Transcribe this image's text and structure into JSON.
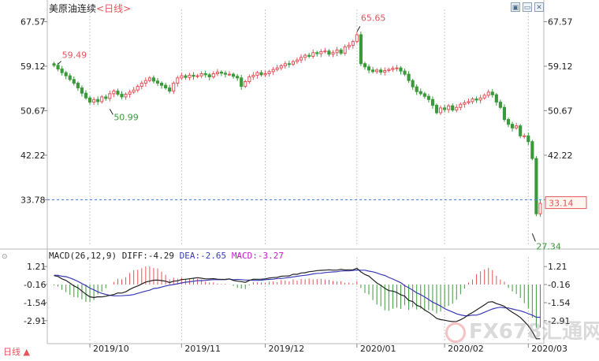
{
  "window": {
    "title": "美原油连续",
    "period": "<日线>",
    "bottom_label": "日线 ▲",
    "watermark": "FX678汇通网"
  },
  "macd_header": {
    "params": "MACD(26,12,9)",
    "diff": "DIFF:-4.29",
    "dea": "DEA:-2.65",
    "macd": "MACD:-3.27"
  },
  "colors": {
    "up": "#e4545a",
    "down": "#3a9a3a",
    "dashed_line": "#3a7ad8",
    "diff_line": "#222222",
    "dea_line": "#3a3ab8",
    "current_label_bg": "#fff6f0",
    "current_label_border": "#e4545a"
  },
  "chart_data": {
    "type": "candlestick",
    "x_ticks": [
      "2019/10",
      "2019/11",
      "2019/12",
      "2020/01",
      "2020/02",
      "2020/03"
    ],
    "y_ticks": [
      67.57,
      59.12,
      50.67,
      42.22,
      33.78
    ],
    "y_tick_labels": [
      "67.57",
      "59.12",
      "50.67",
      "42.22",
      "33.78"
    ],
    "ylim": [
      25.0,
      69.0
    ],
    "current_price": "33.14",
    "current_price_value": 33.14,
    "annotations": [
      {
        "text": "59.49",
        "value": 59.49,
        "color": "up"
      },
      {
        "text": "50.99",
        "value": 50.99,
        "color": "down"
      },
      {
        "text": "65.65",
        "value": 65.65,
        "color": "up"
      },
      {
        "text": "27.34",
        "value": 27.34,
        "color": "down"
      }
    ],
    "closes": [
      59.3,
      58.6,
      57.9,
      57.3,
      56.6,
      55.9,
      55.0,
      54.0,
      53.1,
      52.3,
      52.8,
      52.4,
      53.3,
      53.0,
      53.9,
      54.4,
      53.8,
      53.3,
      53.8,
      54.2,
      54.6,
      55.3,
      55.9,
      56.4,
      56.9,
      56.3,
      55.9,
      55.5,
      55.0,
      54.4,
      55.9,
      56.9,
      57.3,
      57.0,
      57.4,
      57.2,
      57.3,
      57.7,
      57.5,
      57.1,
      57.7,
      58.0,
      57.8,
      57.6,
      57.6,
      57.2,
      56.9,
      55.3,
      56.2,
      57.1,
      57.4,
      57.9,
      57.5,
      57.7,
      58.1,
      58.5,
      58.8,
      59.2,
      59.6,
      59.5,
      60.0,
      60.3,
      60.8,
      61.2,
      61.0,
      61.7,
      61.5,
      61.9,
      62.0,
      61.4,
      61.7,
      62.2,
      61.6,
      62.8,
      63.1,
      63.8,
      65.1,
      59.6,
      59.0,
      58.4,
      58.1,
      58.4,
      58.0,
      58.3,
      58.5,
      58.7,
      58.8,
      58.2,
      57.6,
      56.4,
      55.2,
      54.3,
      53.9,
      53.4,
      52.8,
      51.7,
      50.3,
      51.2,
      50.9,
      51.6,
      50.8,
      51.3,
      51.9,
      52.2,
      52.4,
      52.9,
      52.7,
      53.1,
      53.6,
      54.2,
      53.7,
      52.3,
      51.3,
      49.0,
      48.1,
      47.4,
      47.8,
      45.9,
      45.9,
      44.8,
      41.6,
      31.1,
      33.1
    ],
    "diff_ticks": [
      1.21,
      -0.16,
      -1.54,
      -2.91
    ],
    "diff_tick_labels": [
      "1.21",
      "-0.16",
      "-1.54",
      "-2.91"
    ],
    "diff_ylim": [
      -4.3,
      1.7
    ],
    "diff": [
      0.52,
      0.46,
      0.27,
      0.15,
      -0.05,
      -0.26,
      -0.41,
      -0.65,
      -0.9,
      -1.09,
      -1.15,
      -1.09,
      -1.1,
      -1.05,
      -0.98,
      -0.92,
      -0.8,
      -0.81,
      -0.71,
      -0.53,
      -0.38,
      -0.27,
      -0.12,
      0.03,
      0.1,
      0.17,
      0.18,
      0.14,
      0.1,
      -0.01,
      0.1,
      0.12,
      0.22,
      0.24,
      0.28,
      0.32,
      0.36,
      0.32,
      0.27,
      0.27,
      0.29,
      0.25,
      0.23,
      0.24,
      0.27,
      0.15,
      0.1,
      0.06,
      0.01,
      0.15,
      0.25,
      0.24,
      0.25,
      0.27,
      0.34,
      0.37,
      0.39,
      0.47,
      0.49,
      0.5,
      0.62,
      0.62,
      0.72,
      0.74,
      0.82,
      0.85,
      0.9,
      0.92,
      0.94,
      0.96,
      0.94,
      0.94,
      1.0,
      0.95,
      0.96,
      0.96,
      1.08,
      0.8,
      0.61,
      0.48,
      0.22,
      -0.04,
      -0.22,
      -0.45,
      -0.62,
      -0.66,
      -0.76,
      -0.94,
      -1.04,
      -1.37,
      -1.45,
      -1.74,
      -1.85,
      -2.1,
      -2.27,
      -2.49,
      -2.74,
      -2.83,
      -2.87,
      -2.94,
      -2.98,
      -2.97,
      -2.84,
      -2.68,
      -2.46,
      -2.29,
      -2.09,
      -1.9,
      -1.7,
      -1.5,
      -1.47,
      -1.61,
      -1.7,
      -1.82,
      -2.07,
      -2.28,
      -2.45,
      -2.67,
      -2.97,
      -3.29,
      -3.75,
      -4.29,
      -4.29
    ],
    "dea": [
      0.55,
      0.54,
      0.47,
      0.44,
      0.34,
      0.22,
      0.08,
      -0.09,
      -0.24,
      -0.43,
      -0.56,
      -0.72,
      -0.83,
      -0.91,
      -0.98,
      -1.02,
      -1.02,
      -1.01,
      -0.99,
      -0.97,
      -0.92,
      -0.83,
      -0.74,
      -0.66,
      -0.59,
      -0.46,
      -0.43,
      -0.35,
      -0.27,
      -0.21,
      -0.16,
      -0.1,
      -0.04,
      0.02,
      0.05,
      0.09,
      0.14,
      0.14,
      0.16,
      0.19,
      0.21,
      0.21,
      0.21,
      0.21,
      0.26,
      0.2,
      0.23,
      0.21,
      0.18,
      0.18,
      0.16,
      0.16,
      0.17,
      0.21,
      0.23,
      0.25,
      0.3,
      0.3,
      0.34,
      0.38,
      0.42,
      0.47,
      0.51,
      0.54,
      0.59,
      0.65,
      0.69,
      0.7,
      0.75,
      0.78,
      0.8,
      0.82,
      0.87,
      0.88,
      0.88,
      0.91,
      0.95,
      0.93,
      0.93,
      0.86,
      0.81,
      0.72,
      0.61,
      0.53,
      0.38,
      0.26,
      0.12,
      -0.02,
      -0.25,
      -0.4,
      -0.59,
      -0.79,
      -0.93,
      -1.1,
      -1.3,
      -1.5,
      -1.64,
      -1.8,
      -1.99,
      -2.13,
      -2.25,
      -2.39,
      -2.47,
      -2.53,
      -2.54,
      -2.48,
      -2.49,
      -2.4,
      -2.27,
      -2.14,
      -2.02,
      -1.94,
      -1.89,
      -1.93,
      -1.94,
      -2.02,
      -2.09,
      -2.16,
      -2.26,
      -2.38,
      -2.49,
      -2.65,
      -2.65
    ]
  }
}
